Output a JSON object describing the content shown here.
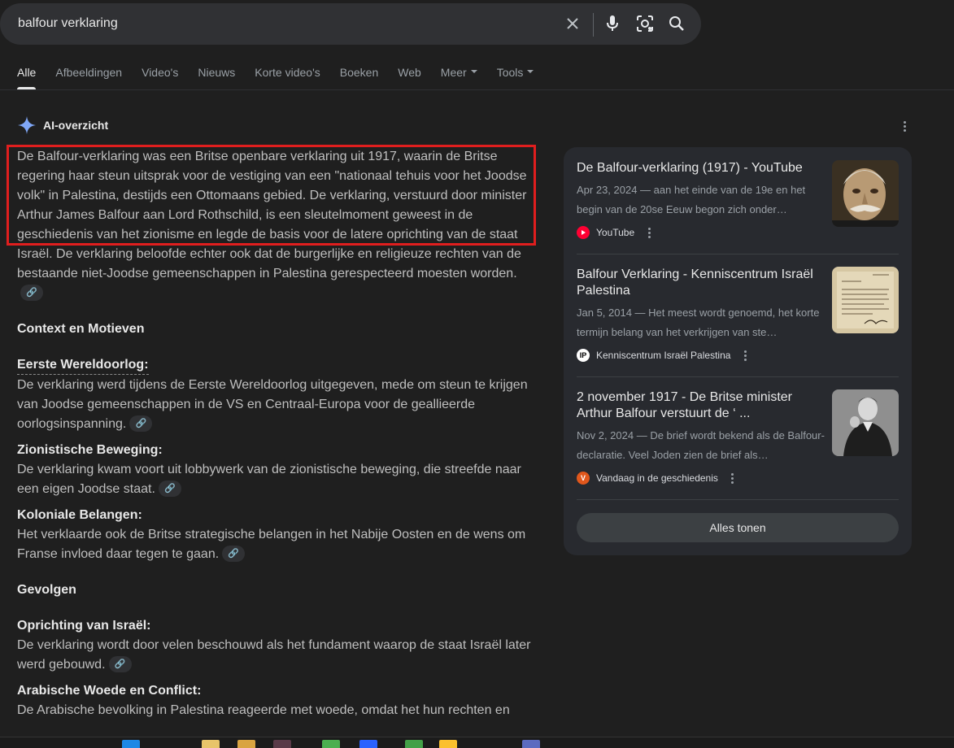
{
  "search": {
    "query": "balfour verklaring",
    "icons": [
      "clear-icon",
      "microphone-icon",
      "lens-icon",
      "search-icon"
    ]
  },
  "tabs": [
    {
      "label": "Alle",
      "active": true
    },
    {
      "label": "Afbeeldingen"
    },
    {
      "label": "Video's"
    },
    {
      "label": "Nieuws"
    },
    {
      "label": "Korte video's"
    },
    {
      "label": "Boeken"
    },
    {
      "label": "Web"
    },
    {
      "label": "Meer",
      "dropdown": true
    },
    {
      "label": "Tools",
      "dropdown": true
    }
  ],
  "ai_overview": {
    "label": "AI-overzicht",
    "intro_highlighted": "De Balfour-verklaring was een Britse openbare verklaring uit 1917, waarin de Britse regering haar steun uitsprak voor de vestiging van een \"nationaal tehuis voor het Joodse volk\" in Palestina, destijds een Ottomaans gebied. De verklaring, verstuurd door minister Arthur James Balfour aan Lord Rothschild, is een sleutelmoment geweest in de geschiedenis van het zionisme en legde de basis voor de latere oprichting van de staat",
    "intro_rest": "Israël. De verklaring beloofde echter ook dat de burgerlijke en religieuze rechten van de bestaande niet-Joodse gemeenschappen in Palestina gerespecteerd moesten worden.",
    "section1_title": "Context en Motieven",
    "points1": [
      {
        "title": "Eerste Wereldoorlog:",
        "text": "De verklaring werd tijdens de Eerste Wereldoorlog uitgegeven, mede om steun te krijgen van Joodse gemeenschappen in de VS en Centraal-Europa voor de geallieerde oorlogsinspanning."
      },
      {
        "title": "Zionistische Beweging:",
        "text": "De verklaring kwam voort uit lobbywerk van de zionistische beweging, die streefde naar een eigen Joodse staat."
      },
      {
        "title": "Koloniale Belangen:",
        "text": "Het verklaarde ook de Britse strategische belangen in het Nabije Oosten en de wens om Franse invloed daar tegen te gaan."
      }
    ],
    "section2_title": "Gevolgen",
    "points2": [
      {
        "title": "Oprichting van Israël:",
        "text": "De verklaring wordt door velen beschouwd als het fundament waarop de staat Israël later werd gebouwd."
      },
      {
        "title": "Arabische Woede en Conflict:",
        "text": "De Arabische bevolking in Palestina reageerde met woede, omdat het hun rechten en"
      }
    ]
  },
  "sources": [
    {
      "title": "De Balfour-verklaring (1917) - YouTube",
      "snippet": "Apr 23, 2024 — aan het einde van de 19e en het begin van de 20se Eeuw begon zich onder…",
      "source": "YouTube",
      "thumb": "portrait-photo"
    },
    {
      "title": "Balfour Verklaring - Kenniscentrum Israël Palestina",
      "snippet": "Jan 5, 2014 — Het meest wordt genoemd, het korte termijn belang van het verkrijgen van ste…",
      "source": "Kenniscentrum Israël Palestina",
      "thumb": "letter-document"
    },
    {
      "title": "2 november 1917 - De Britse minister Arthur Balfour verstuurt de ‘ ...",
      "snippet": "Nov 2, 2024 — De brief wordt bekend als de Balfour-declaratie. Veel Joden zien de brief als…",
      "source": "Vandaag in de geschiedenis",
      "thumb": "bw-portrait"
    }
  ],
  "show_all_label": "Alles tonen",
  "colors": {
    "background": "#1f1f1f",
    "highlight_border": "#e01e1e",
    "panel": "#282a2f"
  }
}
